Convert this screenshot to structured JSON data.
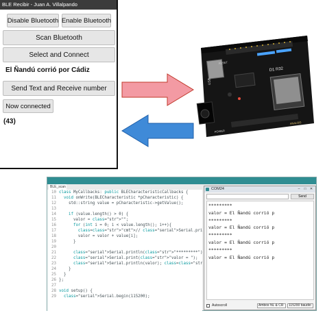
{
  "app": {
    "title": "BLE Recibir - Juan A. Villalpando",
    "disable_bluetooth": "Disable Bluetooth",
    "enable_bluetooth": "Enable Bluetooth",
    "scan_bluetooth": "Scan Bluetooth",
    "select_connect": "Select and Connect",
    "text_to_send": "El Ñandú corrió por Cádiz",
    "send_receive": "Send Text and Receive number",
    "status": "Now connected",
    "result": "(43)"
  },
  "arrows": {
    "to_board_color": "#f39aa3",
    "to_phone_color": "#3f8ad8"
  },
  "board": {
    "model": "D1 R32",
    "usb_label": "USB",
    "power_label": "POWER",
    "analog_label": "ANALOG",
    "reset_label": "RESET"
  },
  "ide": {
    "tab": "BLE_scan",
    "code_lines": [
      {
        "n": "10",
        "t": "class MyCallbacks: public BLECharacteristicCallbacks {"
      },
      {
        "n": "11",
        "t": "  void onWrite(BLECharacteristic *pCharacteristic) {"
      },
      {
        "n": "12",
        "t": "    std::string value = pCharacteristic->getValue();"
      },
      {
        "n": "13",
        "t": ""
      },
      {
        "n": "14",
        "t": "    if (value.length() > 0) {"
      },
      {
        "n": "15",
        "t": "      valor = \"\";"
      },
      {
        "n": "16",
        "t": "      for (int i = 0; i < value.length(); i++){"
      },
      {
        "n": "17",
        "t": "        // Serial.print(value[i]); // Presenta value."
      },
      {
        "n": "18",
        "t": "        valor = valor + value[i];"
      },
      {
        "n": "19",
        "t": "      }"
      },
      {
        "n": "20",
        "t": ""
      },
      {
        "n": "21",
        "t": "      Serial.println(\"*********\");"
      },
      {
        "n": "22",
        "t": "      Serial.print(\"valor = \");"
      },
      {
        "n": "23",
        "t": "      Serial.println(valor); // Presenta valor."
      },
      {
        "n": "24",
        "t": "    }"
      },
      {
        "n": "25",
        "t": "  }"
      },
      {
        "n": "26",
        "t": "};"
      },
      {
        "n": "27",
        "t": ""
      },
      {
        "n": "28",
        "t": "void setup() {"
      },
      {
        "n": "29",
        "t": "  Serial.begin(115200);"
      }
    ],
    "serial": {
      "title": "COM24",
      "send_label": "Send",
      "lines": [
        "*********",
        "valor = El Ñandú corrió p",
        "*********",
        "valor = El Ñandú corrió p",
        "*********",
        "valor = El Ñandú corrió p",
        "*********",
        "valor = El Ñandú corrió p"
      ],
      "autoscroll": "Autoscroll",
      "line_ending": "Ambos NL & CR",
      "baud": "115200 baudio"
    }
  }
}
